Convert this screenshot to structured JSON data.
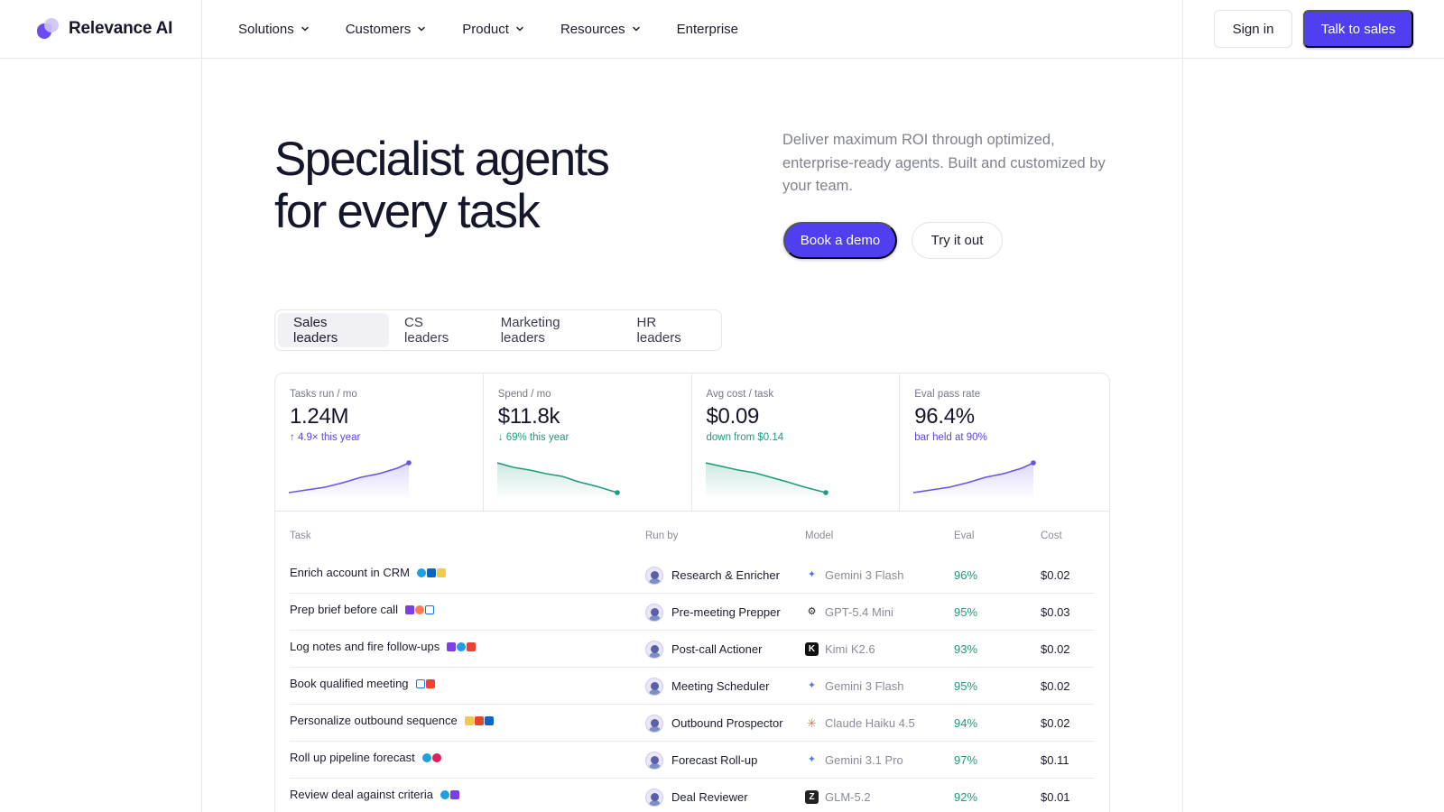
{
  "brand": {
    "name": "Relevance AI"
  },
  "nav": {
    "items": [
      {
        "label": "Solutions",
        "has_dropdown": true
      },
      {
        "label": "Customers",
        "has_dropdown": true
      },
      {
        "label": "Product",
        "has_dropdown": true
      },
      {
        "label": "Resources",
        "has_dropdown": true
      },
      {
        "label": "Enterprise",
        "has_dropdown": false
      }
    ],
    "signin_label": "Sign in",
    "cta_label": "Talk to sales"
  },
  "hero": {
    "title_line1": "Specialist agents",
    "title_line2": "for every task",
    "subtitle": "Deliver maximum ROI through optimized, enterprise-ready agents. Built and customized by your team.",
    "primary_button": "Book a demo",
    "secondary_button": "Try it out"
  },
  "tabs": [
    {
      "label": "Sales leaders",
      "active": true
    },
    {
      "label": "CS leaders",
      "active": false
    },
    {
      "label": "Marketing leaders",
      "active": false
    },
    {
      "label": "HR leaders",
      "active": false
    }
  ],
  "metrics": [
    {
      "label": "Tasks run / mo",
      "value": "1.24M",
      "delta": "↑ 4.9× this year",
      "tone": "purple"
    },
    {
      "label": "Spend / mo",
      "value": "$11.8k",
      "delta": "↓ 69% this year",
      "tone": "green"
    },
    {
      "label": "Avg cost / task",
      "value": "$0.09",
      "delta": "down from $0.14",
      "tone": "green"
    },
    {
      "label": "Eval pass rate",
      "value": "96.4%",
      "delta": "bar held at 90%",
      "tone": "purple"
    }
  ],
  "table": {
    "headers": {
      "task": "Task",
      "run_by": "Run by",
      "model": "Model",
      "eval": "Eval",
      "cost": "Cost"
    },
    "rows": [
      {
        "task": "Enrich account in CRM",
        "apps": [
          "salesforce-icon",
          "linkedin-icon",
          "apollo-icon"
        ],
        "agent": "Research & Enricher",
        "model": "Gemini 3 Flash",
        "model_icon": "gemini-icon",
        "eval": "96%",
        "cost": "$0.02"
      },
      {
        "task": "Prep brief before call",
        "apps": [
          "gong-icon",
          "hubspot-icon",
          "google-calendar-icon"
        ],
        "agent": "Pre-meeting Prepper",
        "model": "GPT-5.4 Mini",
        "model_icon": "openai-icon",
        "eval": "95%",
        "cost": "$0.03"
      },
      {
        "task": "Log notes and fire follow-ups",
        "apps": [
          "gong-icon",
          "salesforce-icon",
          "gmail-icon"
        ],
        "agent": "Post-call Actioner",
        "model": "Kimi K2.6",
        "model_icon": "kimi-icon",
        "eval": "93%",
        "cost": "$0.02"
      },
      {
        "task": "Book qualified meeting",
        "apps": [
          "google-calendar-icon",
          "gmail-icon"
        ],
        "agent": "Meeting Scheduler",
        "model": "Gemini 3 Flash",
        "model_icon": "gemini-icon",
        "eval": "95%",
        "cost": "$0.02"
      },
      {
        "task": "Personalize outbound sequence",
        "apps": [
          "apollo-icon",
          "gmail-icon",
          "linkedin-icon"
        ],
        "agent": "Outbound Prospector",
        "model": "Claude Haiku 4.5",
        "model_icon": "claude-icon",
        "eval": "94%",
        "cost": "$0.02"
      },
      {
        "task": "Roll up pipeline forecast",
        "apps": [
          "salesforce-icon",
          "slack-icon"
        ],
        "agent": "Forecast Roll-up",
        "model": "Gemini 3.1 Pro",
        "model_icon": "gemini-icon",
        "eval": "97%",
        "cost": "$0.11"
      },
      {
        "task": "Review deal against criteria",
        "apps": [
          "salesforce-icon",
          "gong-icon"
        ],
        "agent": "Deal Reviewer",
        "model": "GLM-5.2",
        "model_icon": "zhipu-icon",
        "eval": "92%",
        "cost": "$0.01"
      }
    ]
  },
  "colors": {
    "accent": "#4f3ff0",
    "purple_trend": "#6a52e6",
    "green_trend": "#1f9a7d"
  }
}
